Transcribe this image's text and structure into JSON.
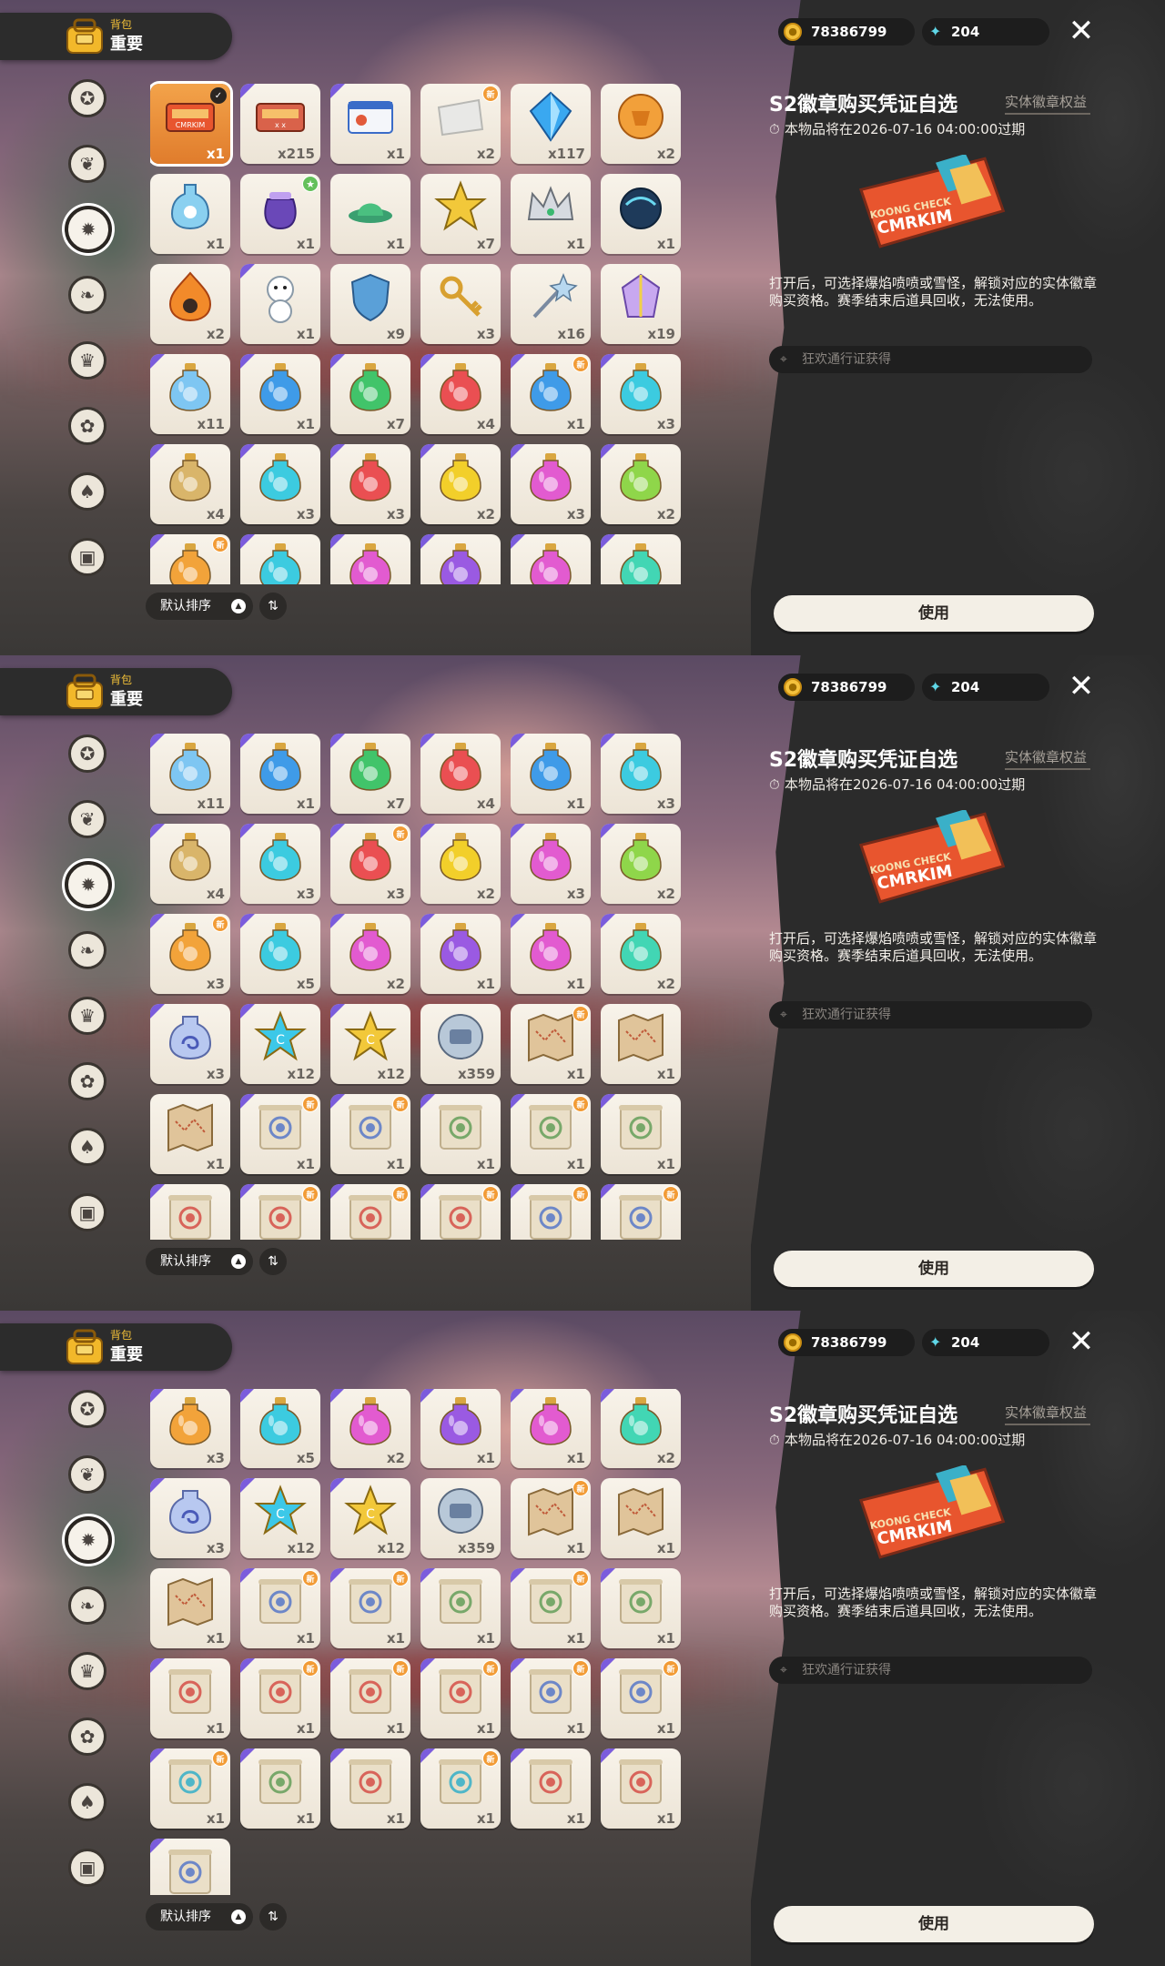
{
  "topbar": {
    "category": "背包",
    "title": "重要"
  },
  "currency": {
    "coins": "78386799",
    "gems": "204"
  },
  "detail": {
    "title": "S2徽章购买凭证自选",
    "type_label": "实体徽章权益",
    "expiry": "本物品将在2026-07-16 04:00:00过期",
    "description": "打开后，可选择爆焰喷喷或雪怪，解锁对应的实体徽章购买资格。赛季结束后道具回收，无法使用。",
    "source": "狂欢通行证获得",
    "use_button": "使用",
    "ticket_text_1": "KOONG CHECK",
    "ticket_text_2": "CMRKIM"
  },
  "sort": {
    "label": "默认排序"
  },
  "nav_icons": [
    "star-badge-icon",
    "leaf-icon",
    "sparkle-badge-icon",
    "leaf-pair-icon",
    "crown-flag-icon",
    "paw-badge-icon",
    "acorn-icon",
    "couch-icon"
  ],
  "colors": {
    "bg_panel": "#2b2b2b",
    "accent_gold": "#f2c038",
    "new_badge": "#f29b35",
    "cell": "#f4eee4"
  },
  "panels": [
    {
      "rows": [
        [
          {
            "q": "x1",
            "art": "ticket",
            "sel": true,
            "mark": "check"
          },
          {
            "q": "x215",
            "art": "ticket-red",
            "corner": true
          },
          {
            "q": "x1",
            "art": "card-blue",
            "corner": true
          },
          {
            "q": "x2",
            "art": "paper",
            "mark": "new"
          },
          {
            "q": "x117",
            "art": "crystal-blue"
          },
          {
            "q": "x2",
            "art": "coin-orange"
          }
        ],
        [
          {
            "q": "x1",
            "art": "bottle-blue"
          },
          {
            "q": "x1",
            "art": "pouch-purple",
            "mark": "star"
          },
          {
            "q": "x1",
            "art": "hat-green"
          },
          {
            "q": "x7",
            "art": "star-gold"
          },
          {
            "q": "x1",
            "art": "crown-silver"
          },
          {
            "q": "x1",
            "art": "orb-night"
          }
        ],
        [
          {
            "q": "x2",
            "art": "flame"
          },
          {
            "q": "x1",
            "art": "snowman",
            "corner": true
          },
          {
            "q": "x9",
            "art": "shield-blue"
          },
          {
            "q": "x3",
            "art": "key-gold"
          },
          {
            "q": "x16",
            "art": "wand-silver"
          },
          {
            "q": "x19",
            "art": "gem-multi"
          }
        ],
        [
          {
            "q": "x11",
            "art": "potion-lightblue",
            "corner": true
          },
          {
            "q": "x1",
            "art": "potion-blue",
            "corner": true
          },
          {
            "q": "x7",
            "art": "potion-green",
            "corner": true
          },
          {
            "q": "x4",
            "art": "potion-red",
            "corner": true
          },
          {
            "q": "x1",
            "art": "potion-blue",
            "corner": true,
            "mark": "new"
          },
          {
            "q": "x3",
            "art": "potion-cyan",
            "corner": true
          }
        ],
        [
          {
            "q": "x4",
            "art": "potion-tan",
            "corner": true
          },
          {
            "q": "x3",
            "art": "potion-cyan",
            "corner": true
          },
          {
            "q": "x3",
            "art": "potion-red",
            "corner": true
          },
          {
            "q": "x2",
            "art": "potion-yellow",
            "corner": true
          },
          {
            "q": "x3",
            "art": "potion-pink",
            "corner": true
          },
          {
            "q": "x2",
            "art": "potion-lime",
            "corner": true
          }
        ],
        [
          {
            "q": "",
            "art": "potion-orange",
            "corner": true,
            "mark": "new"
          },
          {
            "q": "",
            "art": "potion-cyan",
            "corner": true
          },
          {
            "q": "",
            "art": "potion-pink",
            "corner": true
          },
          {
            "q": "",
            "art": "potion-purple",
            "corner": true
          },
          {
            "q": "",
            "art": "potion-pink",
            "corner": true
          },
          {
            "q": "",
            "art": "potion-teal",
            "corner": true
          }
        ]
      ]
    },
    {
      "rows": [
        [
          {
            "q": "x11",
            "art": "potion-lightblue",
            "corner": true
          },
          {
            "q": "x1",
            "art": "potion-blue",
            "corner": true
          },
          {
            "q": "x7",
            "art": "potion-green",
            "corner": true
          },
          {
            "q": "x4",
            "art": "potion-red",
            "corner": true
          },
          {
            "q": "x1",
            "art": "potion-blue",
            "corner": true
          },
          {
            "q": "x3",
            "art": "potion-cyan",
            "corner": true
          }
        ],
        [
          {
            "q": "x4",
            "art": "potion-tan",
            "corner": true
          },
          {
            "q": "x3",
            "art": "potion-cyan",
            "corner": true
          },
          {
            "q": "x3",
            "art": "potion-red",
            "corner": true,
            "mark": "new"
          },
          {
            "q": "x2",
            "art": "potion-yellow",
            "corner": true
          },
          {
            "q": "x3",
            "art": "potion-pink",
            "corner": true
          },
          {
            "q": "x2",
            "art": "potion-lime",
            "corner": true
          }
        ],
        [
          {
            "q": "x3",
            "art": "potion-orange",
            "corner": true,
            "mark": "new"
          },
          {
            "q": "x5",
            "art": "potion-cyan",
            "corner": true
          },
          {
            "q": "x2",
            "art": "potion-pink",
            "corner": true
          },
          {
            "q": "x1",
            "art": "potion-purple",
            "corner": true
          },
          {
            "q": "x1",
            "art": "potion-pink",
            "corner": true
          },
          {
            "q": "x2",
            "art": "potion-teal",
            "corner": true
          }
        ],
        [
          {
            "q": "x3",
            "art": "swirl-bottle",
            "corner": true
          },
          {
            "q": "x12",
            "art": "star-cyan",
            "corner": true
          },
          {
            "q": "x12",
            "art": "star-yellow",
            "corner": true
          },
          {
            "q": "x359",
            "art": "coin-silver"
          },
          {
            "q": "x1",
            "art": "map",
            "mark": "new"
          },
          {
            "q": "x1",
            "art": "map"
          }
        ],
        [
          {
            "q": "x1",
            "art": "map"
          },
          {
            "q": "x1",
            "art": "scroll-blue",
            "corner": true,
            "mark": "new"
          },
          {
            "q": "x1",
            "art": "scroll-blue",
            "corner": true,
            "mark": "new"
          },
          {
            "q": "x1",
            "art": "scroll-green",
            "corner": true
          },
          {
            "q": "x1",
            "art": "scroll-green",
            "corner": true,
            "mark": "new"
          },
          {
            "q": "x1",
            "art": "scroll-green",
            "corner": true
          }
        ],
        [
          {
            "q": "",
            "art": "scroll-red",
            "corner": true
          },
          {
            "q": "",
            "art": "scroll-red",
            "corner": true,
            "mark": "new"
          },
          {
            "q": "",
            "art": "scroll-red",
            "corner": true,
            "mark": "new"
          },
          {
            "q": "",
            "art": "scroll-red",
            "corner": true,
            "mark": "new"
          },
          {
            "q": "",
            "art": "scroll-blue",
            "corner": true,
            "mark": "new"
          },
          {
            "q": "",
            "art": "scroll-blue",
            "corner": true,
            "mark": "new"
          }
        ]
      ]
    },
    {
      "rows": [
        [
          {
            "q": "x3",
            "art": "potion-orange",
            "corner": true
          },
          {
            "q": "x5",
            "art": "potion-cyan",
            "corner": true
          },
          {
            "q": "x2",
            "art": "potion-pink",
            "corner": true
          },
          {
            "q": "x1",
            "art": "potion-purple",
            "corner": true
          },
          {
            "q": "x1",
            "art": "potion-pink",
            "corner": true
          },
          {
            "q": "x2",
            "art": "potion-teal",
            "corner": true
          }
        ],
        [
          {
            "q": "x3",
            "art": "swirl-bottle",
            "corner": true
          },
          {
            "q": "x12",
            "art": "star-cyan",
            "corner": true
          },
          {
            "q": "x12",
            "art": "star-yellow",
            "corner": true
          },
          {
            "q": "x359",
            "art": "coin-silver"
          },
          {
            "q": "x1",
            "art": "map",
            "mark": "new"
          },
          {
            "q": "x1",
            "art": "map"
          }
        ],
        [
          {
            "q": "x1",
            "art": "map"
          },
          {
            "q": "x1",
            "art": "scroll-blue",
            "corner": true,
            "mark": "new"
          },
          {
            "q": "x1",
            "art": "scroll-blue",
            "corner": true,
            "mark": "new"
          },
          {
            "q": "x1",
            "art": "scroll-green",
            "corner": true
          },
          {
            "q": "x1",
            "art": "scroll-green",
            "corner": true,
            "mark": "new"
          },
          {
            "q": "x1",
            "art": "scroll-green",
            "corner": true
          }
        ],
        [
          {
            "q": "x1",
            "art": "scroll-red",
            "corner": true
          },
          {
            "q": "x1",
            "art": "scroll-red",
            "corner": true,
            "mark": "new"
          },
          {
            "q": "x1",
            "art": "scroll-red",
            "corner": true,
            "mark": "new"
          },
          {
            "q": "x1",
            "art": "scroll-red",
            "corner": true,
            "mark": "new"
          },
          {
            "q": "x1",
            "art": "scroll-blue",
            "corner": true,
            "mark": "new"
          },
          {
            "q": "x1",
            "art": "scroll-blue",
            "corner": true,
            "mark": "new"
          }
        ],
        [
          {
            "q": "x1",
            "art": "scroll-cyan",
            "corner": true,
            "mark": "new"
          },
          {
            "q": "x1",
            "art": "scroll-green",
            "corner": true
          },
          {
            "q": "x1",
            "art": "scroll-red",
            "corner": true
          },
          {
            "q": "x1",
            "art": "scroll-cyan",
            "corner": true,
            "mark": "new"
          },
          {
            "q": "x1",
            "art": "scroll-red",
            "corner": true
          },
          {
            "q": "x1",
            "art": "scroll-red",
            "corner": true
          }
        ],
        [
          {
            "q": "x1",
            "art": "scroll-blue",
            "corner": true
          }
        ]
      ]
    }
  ]
}
